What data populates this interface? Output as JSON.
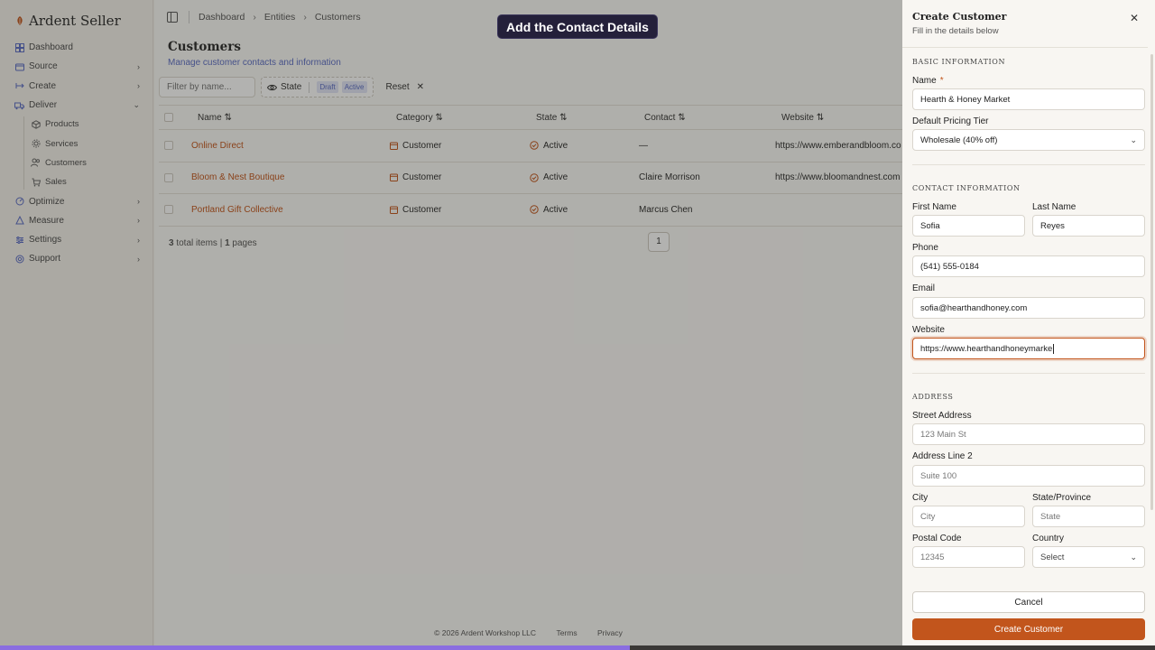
{
  "brand": {
    "name": "Ardent Seller"
  },
  "sidebar": {
    "items": [
      {
        "label": "Dashboard",
        "icon": "dashboard-icon",
        "chevron": ""
      },
      {
        "label": "Source",
        "icon": "source-icon",
        "chevron": "›"
      },
      {
        "label": "Create",
        "icon": "create-icon",
        "chevron": "›"
      },
      {
        "label": "Deliver",
        "icon": "deliver-icon",
        "chevron": "⌄"
      }
    ],
    "subitems": [
      {
        "label": "Products",
        "icon": "box-icon"
      },
      {
        "label": "Services",
        "icon": "gear-icon"
      },
      {
        "label": "Customers",
        "icon": "users-icon"
      },
      {
        "label": "Sales",
        "icon": "cart-icon"
      }
    ],
    "items_after": [
      {
        "label": "Optimize",
        "icon": "optimize-icon",
        "chevron": "›"
      },
      {
        "label": "Measure",
        "icon": "measure-icon",
        "chevron": "›"
      },
      {
        "label": "Settings",
        "icon": "settings-icon",
        "chevron": "›"
      },
      {
        "label": "Support",
        "icon": "support-icon",
        "chevron": "›"
      }
    ]
  },
  "breadcrumb": [
    "Dashboard",
    "Entities",
    "Customers"
  ],
  "page": {
    "title": "Customers",
    "subtitle": "Manage customer contacts and information"
  },
  "filters": {
    "placeholder": "Filter by name...",
    "state_label": "State",
    "chips": [
      "Draft",
      "Active"
    ],
    "reset_label": "Reset"
  },
  "table": {
    "headers": [
      "Name",
      "Category",
      "State",
      "Contact",
      "Website"
    ],
    "rows": [
      {
        "name": "Online Direct",
        "category": "Customer",
        "state": "Active",
        "contact": "—",
        "website": "https://www.emberandbloom.co"
      },
      {
        "name": "Bloom & Nest Boutique",
        "category": "Customer",
        "state": "Active",
        "contact": "Claire Morrison",
        "website": "https://www.bloomandnest.com"
      },
      {
        "name": "Portland Gift Collective",
        "category": "Customer",
        "state": "Active",
        "contact": "Marcus Chen",
        "website": ""
      }
    ],
    "footer": {
      "total": "3",
      "total_label": "total items",
      "pages": "1",
      "pages_label": "pages",
      "current_page": "1"
    }
  },
  "footer": {
    "copyright": "© 2026 Ardent Workshop LLC",
    "terms": "Terms",
    "privacy": "Privacy"
  },
  "banner": {
    "text": "Add the Contact Details"
  },
  "progress": {
    "fraction": 0.545
  },
  "drawer": {
    "title": "Create Customer",
    "subtitle": "Fill in the details below",
    "sections": {
      "basic": "BASIC INFORMATION",
      "contact": "CONTACT INFORMATION",
      "address": "ADDRESS"
    },
    "fields": {
      "name": {
        "label": "Name",
        "value": "Hearth & Honey Market"
      },
      "pricing": {
        "label": "Default Pricing Tier",
        "value": "Wholesale (40% off)"
      },
      "first_name": {
        "label": "First Name",
        "value": "Sofia"
      },
      "last_name": {
        "label": "Last Name",
        "value": "Reyes"
      },
      "phone": {
        "label": "Phone",
        "value": "(541) 555-0184"
      },
      "email": {
        "label": "Email",
        "value": "sofia@hearthandhoney.com"
      },
      "website": {
        "label": "Website",
        "value": "https://www.hearthandhoneymarke"
      },
      "street": {
        "label": "Street Address",
        "placeholder": "123 Main St"
      },
      "line2": {
        "label": "Address Line 2",
        "placeholder": "Suite 100"
      },
      "city": {
        "label": "City",
        "placeholder": "City"
      },
      "state": {
        "label": "State/Province",
        "placeholder": "State"
      },
      "postal": {
        "label": "Postal Code",
        "placeholder": "12345"
      },
      "country": {
        "label": "Country",
        "placeholder": "Select"
      }
    },
    "cancel_label": "Cancel",
    "create_label": "Create Customer"
  },
  "colors": {
    "accent": "#c2551c",
    "link": "#5b6dc5",
    "banner": "#24203a",
    "progress": "#8a6de0"
  }
}
